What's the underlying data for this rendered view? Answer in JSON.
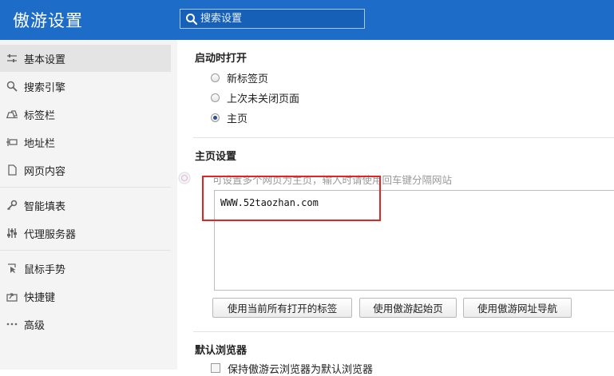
{
  "header": {
    "title": "傲游设置",
    "search": {
      "placeholder": "搜索设置",
      "icon": "search-icon"
    }
  },
  "sidebar": {
    "items": [
      {
        "label": "基本设置",
        "icon": "sliders-icon",
        "active": true
      },
      {
        "label": "搜索引擎",
        "icon": "magnifier-icon"
      },
      {
        "label": "标签栏",
        "icon": "tab-icon"
      },
      {
        "label": "地址栏",
        "icon": "address-bar-icon"
      },
      {
        "label": "网页内容",
        "icon": "page-icon"
      },
      {
        "label": "智能填表",
        "icon": "key-icon"
      },
      {
        "label": "代理服务器",
        "icon": "proxy-icon"
      },
      {
        "label": "鼠标手势",
        "icon": "cursor-icon"
      },
      {
        "label": "快捷键",
        "icon": "shortcut-icon"
      },
      {
        "label": "高级",
        "icon": "more-icon"
      }
    ]
  },
  "main": {
    "startup": {
      "title": "启动时打开",
      "options": [
        {
          "label": "新标签页",
          "checked": false
        },
        {
          "label": "上次未关闭页面",
          "checked": false
        },
        {
          "label": "主页",
          "checked": true
        }
      ]
    },
    "homepage": {
      "title": "主页设置",
      "hint": "可设置多个网页为主页，输入时请使用回车键分隔网站",
      "value": "WWW.52taozhan.com",
      "buttons": {
        "use_current": "使用当前所有打开的标签",
        "use_start": "使用傲游起始页",
        "use_nav": "使用傲游网址导航"
      }
    },
    "default_browser": {
      "title": "默认浏览器",
      "checkbox_label": "保持傲游云浏览器为默认浏览器"
    }
  },
  "colors": {
    "header_bg": "#1d6cc8",
    "sidebar_bg": "#f4f4f4",
    "sidebar_active_bg": "#e4e4e4",
    "highlight_border": "#e02525"
  }
}
